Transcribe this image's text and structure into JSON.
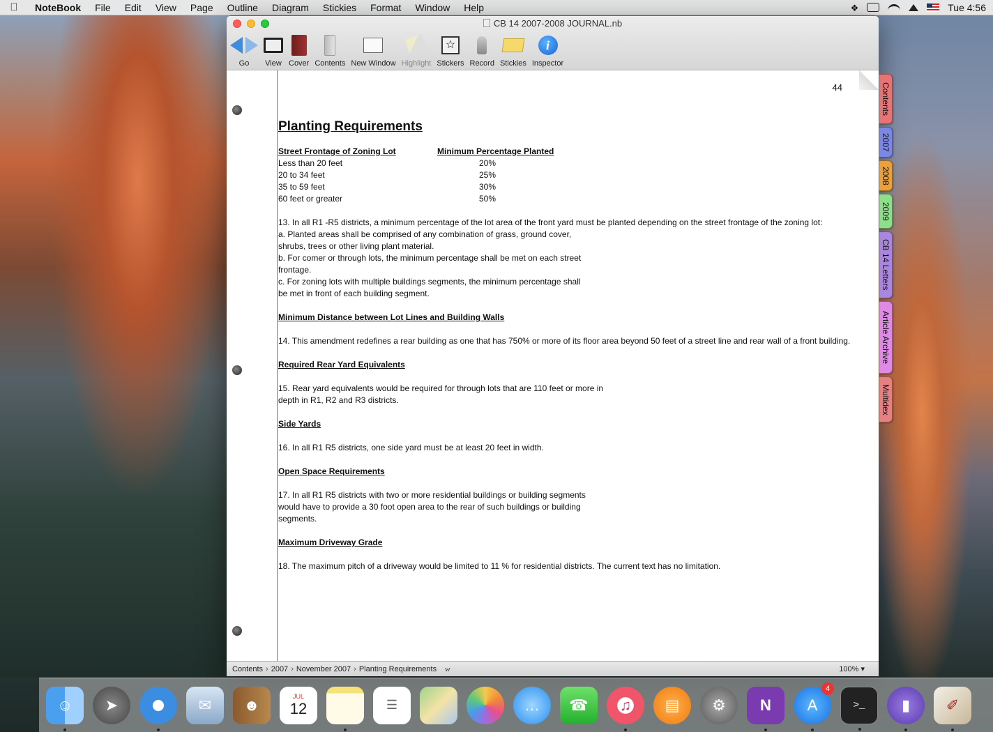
{
  "menubar": {
    "app_name": "NoteBook",
    "items": [
      "File",
      "Edit",
      "View",
      "Page",
      "Outline",
      "Diagram",
      "Stickies",
      "Format",
      "Window",
      "Help"
    ],
    "clock": "Tue 4:56"
  },
  "window": {
    "title": "CB 14 2007-2008 JOURNAL.nb",
    "toolbar": {
      "go": "Go",
      "view": "View",
      "cover": "Cover",
      "contents": "Contents",
      "new_window": "New Window",
      "highlight": "Highlight",
      "stickers": "Stickers",
      "record": "Record",
      "stickies": "Stickies",
      "inspector": "Inspector"
    }
  },
  "page": {
    "number": "44",
    "title": "Planting Requirements",
    "table": {
      "headers": [
        "Street Frontage of Zoning Lot",
        "Minimum Percentage Planted"
      ],
      "rows": [
        [
          "Less than 20 feet",
          "20%"
        ],
        [
          "20 to 34 feet",
          "25%"
        ],
        [
          "35 to 59 feet",
          "30%"
        ],
        [
          "60 feet or greater",
          "50%"
        ]
      ]
    },
    "para13": "13. In all R1 -R5 districts, a minimum percentage of the lot area of the front yard must be planted depending on the street frontage of the zoning lot:\na. Planted areas shall be comprised of any combination of grass, ground cover,\nshrubs, trees or other living plant material.\nb. For comer or through lots, the minimum percentage shall be met on each street\nfrontage.\nc. For zoning lots with multiple buildings segments, the minimum percentage shall\nbe met in front of each building segment.",
    "head14": "Minimum Distance between Lot Lines and Building Walls",
    "para14": "14. This amendment redefines a rear building as one that has 750% or more of its floor area beyond 50 feet of a street line and rear wall of a front building.",
    "head15": "Required Rear Yard Equivalents",
    "para15": "15. Rear yard equivalents would be required for through lots that are 110 feet or more in\ndepth in R1, R2 and R3 districts.",
    "head16": "Side Yards",
    "para16": "16. In all R1 R5 districts, one side yard must be at least 20 feet in width.",
    "head17": "Open Space Requirements",
    "para17": "17. In all R1 R5 districts with two or more residential buildings or building segments\nwould have to provide a 30 foot open area to the rear of such buildings or building\nsegments.",
    "head18": "Maximum Driveway Grade",
    "para18": "18. The maximum pitch of a driveway would be limited to 11 % for residential districts. The current text has no limitation."
  },
  "statusbar": {
    "crumbs": [
      "Contents",
      "2007",
      "November 2007",
      "Planting Requirements"
    ],
    "mark": "w",
    "zoom": "100% ▾"
  },
  "tabs": [
    {
      "label": "Contents",
      "color": "#e77474"
    },
    {
      "label": "2007",
      "color": "#7c86e6"
    },
    {
      "label": "2008",
      "color": "#eba03a"
    },
    {
      "label": "2009",
      "color": "#8ede8a"
    },
    {
      "label": "CB 14 Letters",
      "color": "#a987e0"
    },
    {
      "label": "Article Archive",
      "color": "#de8ae6"
    },
    {
      "label": "Multidex",
      "color": "#e78080"
    }
  ],
  "dock": {
    "app_store_badge": "4",
    "calendar_month": "JUL",
    "calendar_day": "12"
  }
}
